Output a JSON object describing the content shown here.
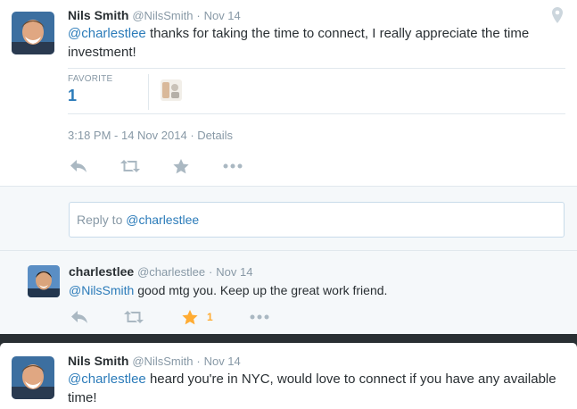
{
  "main_tweet": {
    "fullname": "Nils Smith",
    "username": "@NilsSmith",
    "separator": "·",
    "time": "Nov 14",
    "mention": "@charlestlee",
    "text_line1": " thanks for taking the time to connect, I really appreciate the time",
    "text_line2": "investment!",
    "stats": {
      "favorite_label": "FAVORITE",
      "favorite_count": "1"
    },
    "timestamp": "3:18 PM - 14 Nov 2014",
    "meta_separator": " · ",
    "details_label": "Details",
    "icons": [
      "geo-pin-icon",
      "reply-icon",
      "retweet-icon",
      "favorite-star-icon",
      "more-icon"
    ]
  },
  "reply_box": {
    "prefix": "Reply to ",
    "mention": "@charlestlee"
  },
  "reply_tweet": {
    "fullname": "charlestlee",
    "username": "@charlestlee",
    "separator": "·",
    "time": "Nov 14",
    "mention": "@NilsSmith",
    "text": " good mtg you. Keep up the great work friend.",
    "favorite_count": "1",
    "favorited": true
  },
  "next_tweet": {
    "fullname": "Nils Smith",
    "username": "@NilsSmith",
    "separator": "·",
    "time": "Nov 14",
    "mention": "@charlestlee",
    "text_line1": " heard you're in NYC, would love to connect if you have any available",
    "text_line2": "time!"
  },
  "colors": {
    "link": "#2b7bb9",
    "muted": "#8899a6",
    "text": "#292f33",
    "favorite_active": "#ffac33",
    "action_icon": "#aab8c2",
    "border": "#e1e8ed",
    "background_light": "#f5f8fa"
  }
}
